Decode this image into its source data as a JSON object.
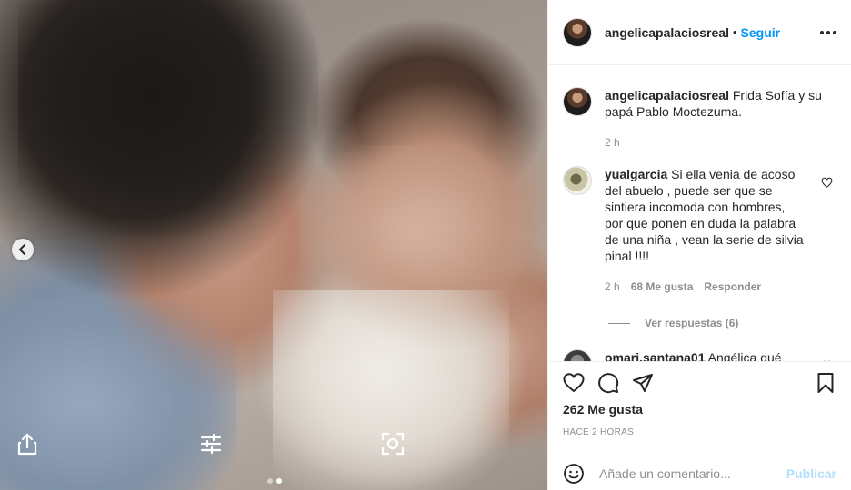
{
  "post": {
    "author": "angelicapalaciosreal",
    "follow_label": "Seguir",
    "separator": "•",
    "caption_user": "angelicapalaciosreal",
    "caption": "Frida Sofía y su papá Pablo Moctezuma.",
    "caption_time": "2 h",
    "carousel": {
      "total": 2,
      "active": 2
    }
  },
  "comments": [
    {
      "user": "yualgarcia",
      "text": "Si ella venia de acoso del abuelo , puede ser que se sintiera incomoda con hombres, por que ponen en duda la palabra de una niña , vean la serie de silvia pinal !!!!",
      "time": "2 h",
      "likes": "68 Me gusta",
      "reply_label": "Responder",
      "view_replies": "Ver respuestas (6)"
    },
    {
      "user": "omari.santana01",
      "text": "Angélica qué"
    }
  ],
  "stats": {
    "likes": "262 Me gusta",
    "time_ago": "HACE 2 HORAS"
  },
  "composer": {
    "placeholder": "Añade un comentario...",
    "publish_label": "Publicar"
  },
  "colors": {
    "accent": "#0095f6",
    "publish_disabled": "#b2dffc",
    "muted": "#8e8e8e",
    "text": "#262626"
  },
  "icons": [
    "chevron-left-icon",
    "share-icon",
    "adjust-icon",
    "lens-icon",
    "more-icon",
    "heart-icon",
    "comment-icon",
    "send-icon",
    "bookmark-icon",
    "emoji-icon"
  ]
}
